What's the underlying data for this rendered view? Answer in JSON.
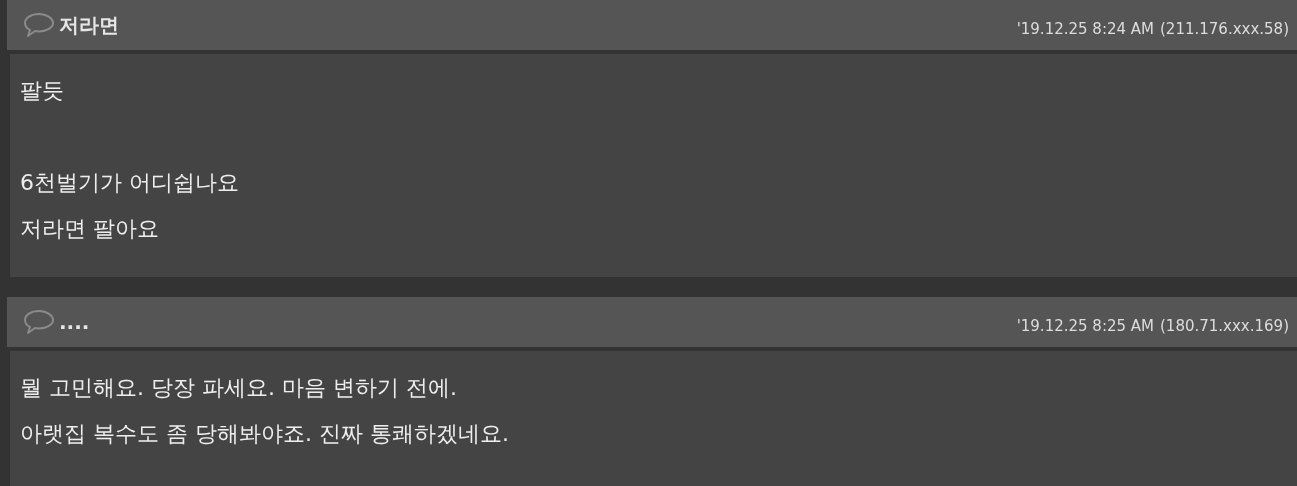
{
  "comments": [
    {
      "author": "저라면",
      "time": "'19.12.25 8:24 AM",
      "ip": "(211.176.xxx.58)",
      "paragraphs": [
        [
          "팔듯"
        ],
        [
          "6천벌기가 어디쉽나요",
          "저라면 팔아요"
        ]
      ]
    },
    {
      "author": "....",
      "time": "'19.12.25 8:25 AM",
      "ip": "(180.71.xxx.169)",
      "paragraphs": [
        [
          "뭘 고민해요. 당장 파세요. 마음 변하기 전에.",
          "아랫집 복수도 좀 당해봐야죠. 진짜 통쾌하겠네요."
        ]
      ]
    }
  ]
}
